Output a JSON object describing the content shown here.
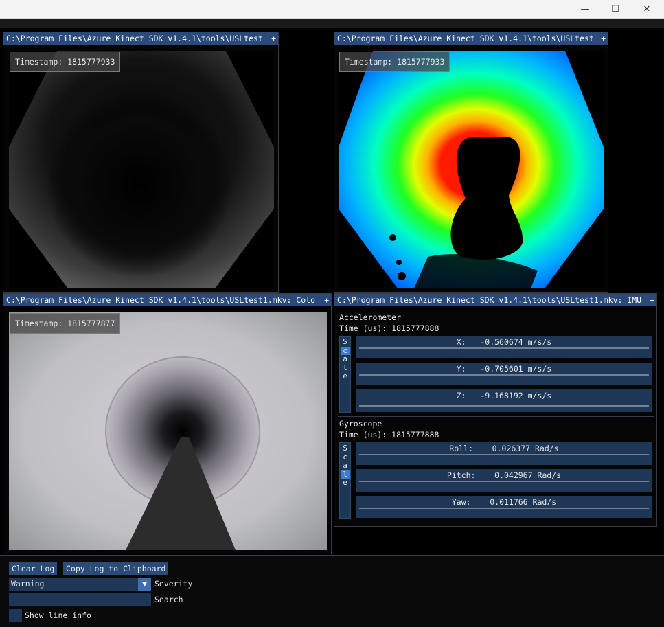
{
  "os_window": {
    "controls": {
      "minimize": "—",
      "maximize": "☐",
      "close": "✕"
    }
  },
  "windows": {
    "ir": {
      "title": "C:\\Program Files\\Azure Kinect SDK v1.4.1\\tools\\USLtest",
      "close_glyph": "+",
      "timestamp": "Timestamp: 1815777933"
    },
    "depth": {
      "title": "C:\\Program Files\\Azure Kinect SDK v1.4.1\\tools\\USLtest",
      "close_glyph": "+",
      "timestamp": "Timestamp: 1815777933"
    },
    "color": {
      "title": "C:\\Program Files\\Azure Kinect SDK v1.4.1\\tools\\USLtest1.mkv: Colo",
      "close_glyph": "+",
      "timestamp": "Timestamp: 1815777877"
    },
    "imu": {
      "title": "C:\\Program Files\\Azure Kinect SDK v1.4.1\\tools\\USLtest1.mkv: IMU",
      "close_glyph": "+",
      "accelerometer": {
        "heading": "Accelerometer",
        "time": "Time (us): 1815777888",
        "scale_letters": [
          "S",
          "c",
          "a",
          "l",
          "e"
        ],
        "active_scale_index": 1,
        "plots": [
          {
            "label": "X:   -0.560674 m/s/s"
          },
          {
            "label": "Y:   -0.705601 m/s/s"
          },
          {
            "label": "Z:   -9.168192 m/s/s"
          }
        ]
      },
      "gyroscope": {
        "heading": "Gyroscope",
        "time": "Time (us): 1815777888",
        "scale_letters": [
          "S",
          "c",
          "a",
          "l",
          "e"
        ],
        "active_scale_index": 3,
        "plots": [
          {
            "label": "Roll:    0.026377 Rad/s"
          },
          {
            "label": "Pitch:    0.042967 Rad/s"
          },
          {
            "label": "Yaw:    0.011766 Rad/s"
          }
        ]
      }
    }
  },
  "log": {
    "clear_button": "Clear Log",
    "copy_button": "Copy Log to Clipboard",
    "severity_value": "Warning",
    "severity_label": "Severity",
    "search_value": "",
    "search_label": "Search",
    "show_line_info_label": "Show line info"
  },
  "colors": {
    "title_bar": "#294a7a",
    "frame_bg": "#1f3756",
    "button": "#2a4a78",
    "accent": "#3d7dd0"
  }
}
